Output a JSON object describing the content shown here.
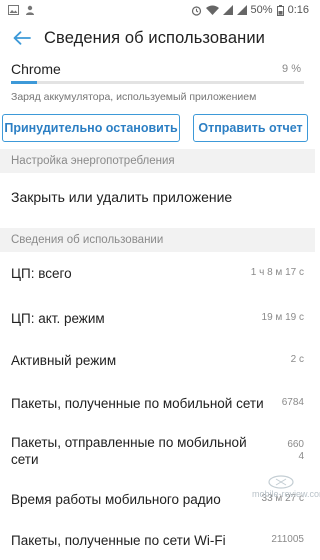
{
  "status_bar": {
    "battery": "50%",
    "time": "0:16"
  },
  "app_bar": {
    "title": "Сведения об использовании"
  },
  "app_usage": {
    "app_name": "Chrome",
    "percent": "9 %",
    "battery_fraction": 0.09,
    "subtitle": "Заряд аккумулятора, используемый приложением",
    "bar_color": "#3d99d8"
  },
  "buttons": {
    "force_stop": "Принудительно остановить",
    "send_report": "Отправить отчет"
  },
  "power_section": {
    "header": "Настройка энергопотребления",
    "close_item": "Закрыть или удалить приложение"
  },
  "usage_section": {
    "header": "Сведения об использовании",
    "items": [
      {
        "label": "ЦП: всего",
        "value": "1 ч 8 м 17 с"
      },
      {
        "label": "ЦП: акт. режим",
        "value": "19 м 19 с"
      },
      {
        "label": "Активный режим",
        "value": "2 с"
      },
      {
        "label": "Пакеты, полученные по мобильной сети",
        "value": "6784"
      },
      {
        "label": "Пакеты, отправленные по мобильной сети",
        "value": "660\n4"
      },
      {
        "label": "Время работы мобильного радио",
        "value": "33 м 27 с"
      },
      {
        "label": "Пакеты, полученные по сети Wi-Fi",
        "value": "211005"
      }
    ]
  },
  "watermark": "mobile-review.com"
}
